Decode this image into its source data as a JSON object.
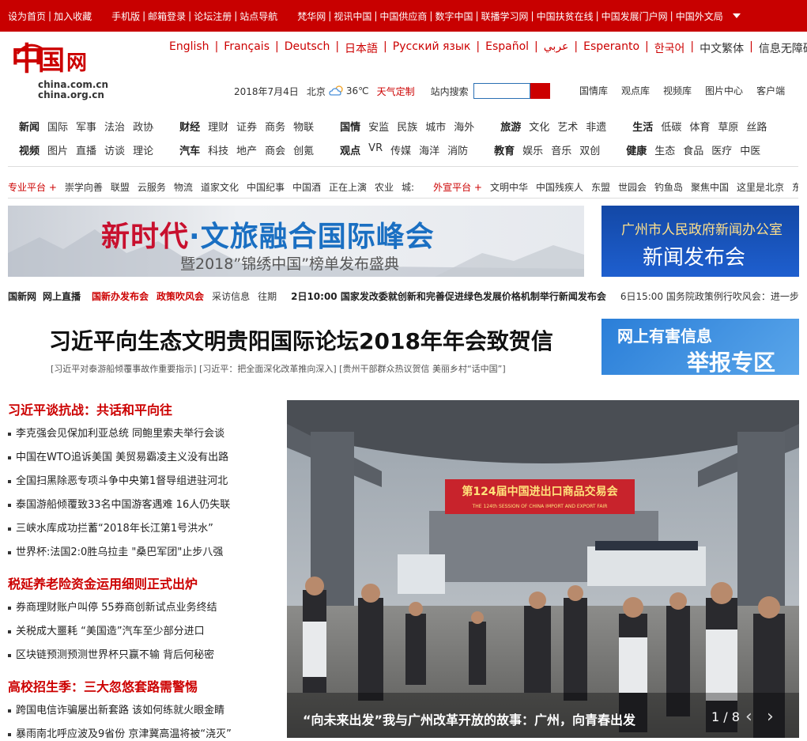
{
  "topbar": {
    "group1": [
      "设为首页",
      "加入收藏"
    ],
    "group2": [
      "手机版",
      "邮箱登录",
      "论坛注册",
      "站点导航"
    ],
    "group3": [
      "梵华网",
      "视讯中国",
      "中国供应商",
      "数字中国",
      "联播学习网",
      "中国扶贫在线",
      "中国发展门户网",
      "中国外文局"
    ]
  },
  "logo": {
    "domain1": "china.com.cn",
    "domain2": "china.org.cn",
    "brand": "中国网"
  },
  "languages": [
    "English",
    "Français",
    "Deutsch",
    "日本語",
    "Русский язык",
    "Español",
    "عربي",
    "Esperanto",
    "한국어",
    "中文繁体",
    "信息无障碍"
  ],
  "info": {
    "date": "2018年7月4日",
    "city": "北京",
    "temp": "36℃",
    "custom": "天气定制",
    "search_label": "站内搜索"
  },
  "libraries": [
    "国情库",
    "观点库",
    "视频库",
    "图片中心",
    "客户端"
  ],
  "nav": {
    "row1": [
      [
        "新闻",
        "国际",
        "军事",
        "法治",
        "政协"
      ],
      [
        "财经",
        "理财",
        "证券",
        "商务",
        "物联"
      ],
      [
        "国情",
        "安监",
        "民族",
        "城市",
        "海外"
      ],
      [
        "旅游",
        "文化",
        "艺术",
        "非遗"
      ],
      [
        "生活",
        "低碳",
        "体育",
        "草原",
        "丝路"
      ]
    ],
    "row2": [
      [
        "视频",
        "图片",
        "直播",
        "访谈",
        "理论"
      ],
      [
        "汽车",
        "科技",
        "地产",
        "商会",
        "创氪"
      ],
      [
        "观点",
        "VR",
        "传媒",
        "海洋",
        "消防"
      ],
      [
        "教育",
        "娱乐",
        "音乐",
        "双创"
      ],
      [
        "健康",
        "生态",
        "食品",
        "医疗",
        "中医"
      ]
    ]
  },
  "platforms": {
    "pro_label": "专业平台 +",
    "pro": [
      "崇学向善",
      "联盟",
      "云服务",
      "物流",
      "道家文化",
      "中国纪事",
      "中国酒",
      "正在上演",
      "农业",
      "城:"
    ],
    "ext_label": "外宣平台 +",
    "ext": [
      "文明中华",
      "中国残疾人",
      "东盟",
      "世园会",
      "钓鱼岛",
      "聚焦中国",
      "这里是北京",
      "东"
    ]
  },
  "banner1": {
    "title_red": "新时代",
    "title_dot": "·",
    "title_blue": "文旅融合国际峰会",
    "subtitle": "暨2018”锦绣中国”榜单发布盛典"
  },
  "banner2": {
    "line1": "广州市人民政府新闻办公室",
    "line2": "新闻发布会"
  },
  "ticker": {
    "items": [
      "国新网",
      "网上直播"
    ],
    "red": [
      "国新办发布会",
      "政策吹风会"
    ],
    "plain": [
      "采访信息",
      "往期"
    ],
    "news1": "2日10:00 国家发改委就创新和完善促进绿色发展价格机制举行新闻发布会",
    "news2": "6日15:00 国务院政策例行吹风会：进一步"
  },
  "headline": "习近平向生态文明贵阳国际论坛2018年年会致贺信",
  "sublinks": "[习近平对泰游船倾覆事故作重要指示] [习近平：把全面深化改革推向深入] [贵州干部群众热议贺信 美丽乡村“话中国”]",
  "banner3": {
    "line1": "网上有害信息",
    "line2": "举报专区"
  },
  "sections": [
    {
      "title": "习近平谈抗战：共话和平向往",
      "items": [
        "李克强会见保加利亚总统 同鲍里索夫举行会谈",
        "中国在WTO追诉美国 美贸易霸凌主义没有出路",
        "全国扫黑除恶专项斗争中央第1督导组进驻河北",
        "泰国游船倾覆致33名中国游客遇难 16人仍失联",
        "三峡水库成功拦蓄“2018年长江第1号洪水”",
        "世界杯:法国2:0胜乌拉圭 \"桑巴军团\"止步八强"
      ]
    },
    {
      "title": "税延养老险资金运用细则正式出炉",
      "items": [
        "券商理财账户叫停 55券商创新试点业务终结",
        "关税成大噩耗 “美国造”汽车至少部分进口",
        "区块链预测预测世界杯只赢不输 背后何秘密"
      ]
    },
    {
      "title": "高校招生季：三大忽悠套路需警惕",
      "items": [
        "跨国电信诈骗屡出新套路 该如何练就火眼金睛",
        "暴雨南北呼应波及9省份 京津冀高温将被“浇灭”"
      ]
    }
  ],
  "photo": {
    "sign_cn": "第124届中国进出口商品交易会",
    "sign_en": "THE 124th SESSION OF CHINA IMPORT AND EXPORT FAIR",
    "caption": "“向未来出发”我与广州改革开放的故事：广州，向青春出发",
    "pager": "1 / 8",
    "prev": "‹",
    "next": "›"
  },
  "colors": {
    "brand_red": "#c80000",
    "link_red": "#cc0000",
    "blue_banner": "#1e5fcf"
  }
}
